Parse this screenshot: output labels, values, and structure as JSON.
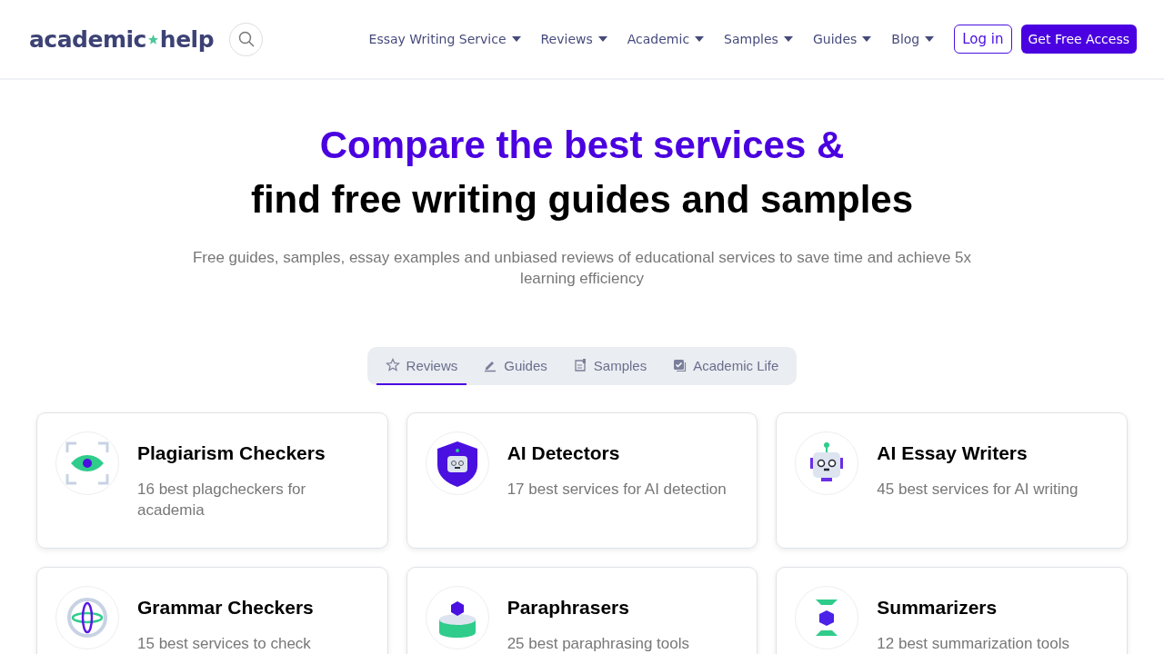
{
  "header": {
    "logo": {
      "left": "academic",
      "right": "help"
    },
    "nav": [
      {
        "label": "Essay Writing Service"
      },
      {
        "label": "Reviews"
      },
      {
        "label": "Academic"
      },
      {
        "label": "Samples"
      },
      {
        "label": "Guides"
      },
      {
        "label": "Blog"
      }
    ],
    "login": "Log in",
    "cta": "Get Free Access"
  },
  "hero": {
    "title_accent": "Compare the best services &",
    "title": "find free writing guides and samples",
    "subtitle": "Free guides, samples, essay examples and unbiased reviews of educational services to save time and achieve 5x learning efficiency"
  },
  "tabs": [
    {
      "label": "Reviews",
      "kind": "star",
      "selected": true
    },
    {
      "label": "Guides",
      "kind": "pencil",
      "selected": false
    },
    {
      "label": "Samples",
      "kind": "document",
      "selected": false
    },
    {
      "label": "Academic Life",
      "kind": "checkbox",
      "selected": false
    }
  ],
  "cards": [
    {
      "title": "Plagiarism Checkers",
      "text": "16 best plagcheckers for academia",
      "kind": "eye"
    },
    {
      "title": "AI Detectors",
      "text": "17 best services for AI detection",
      "kind": "shield"
    },
    {
      "title": "AI Essay Writers",
      "text": "45 best services for AI writing",
      "kind": "robot"
    },
    {
      "title": "Grammar Checkers",
      "text": "15 best services to check",
      "kind": "globe"
    },
    {
      "title": "Paraphrasers",
      "text": "25 best paraphrasing tools",
      "kind": "ring"
    },
    {
      "title": "Summarizers",
      "text": "12 best summarization tools",
      "kind": "hourglass"
    }
  ]
}
